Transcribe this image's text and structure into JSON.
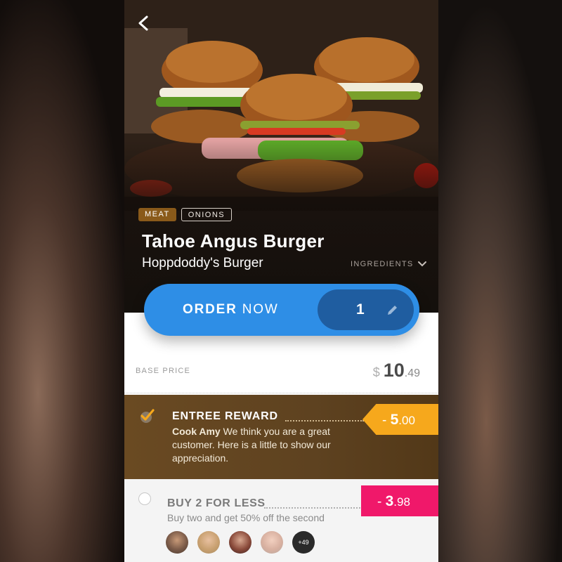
{
  "tags": [
    "MEAT",
    "ONIONS"
  ],
  "product": {
    "title": "Tahoe Angus Burger",
    "subtitle": "Hoppdoddy's Burger",
    "ingredients_label": "INGREDIENTS"
  },
  "order": {
    "label_strong": "ORDER",
    "label_light": "NOW",
    "quantity": "1"
  },
  "price": {
    "label": "BASE PRICE",
    "currency": "$",
    "whole": "10",
    "cents": ".49"
  },
  "reward": {
    "title": "ENTREE REWARD",
    "author": "Cook Amy",
    "message": "We think you are a great customer. Here is a little to show our appreciation.",
    "discount_sign": "- ",
    "discount_whole": "5",
    "discount_cents": ".00",
    "checked": true
  },
  "promo": {
    "title": "BUY 2 FOR LESS",
    "description": "Buy two and get 50% off the second",
    "discount_sign": "- ",
    "discount_whole": "3",
    "discount_cents": ".98",
    "more_count": "+49"
  },
  "colors": {
    "order_blue": "#2e8ee6",
    "qty_blue": "#1f5da0",
    "reward_orange": "#f6a81c",
    "promo_pink": "#f0186a",
    "reward_brown": "#6a4a22"
  },
  "icons": [
    "back-arrow-icon",
    "chevron-down-icon",
    "pencil-icon",
    "checkbox-checked-icon",
    "radio-empty-icon"
  ]
}
